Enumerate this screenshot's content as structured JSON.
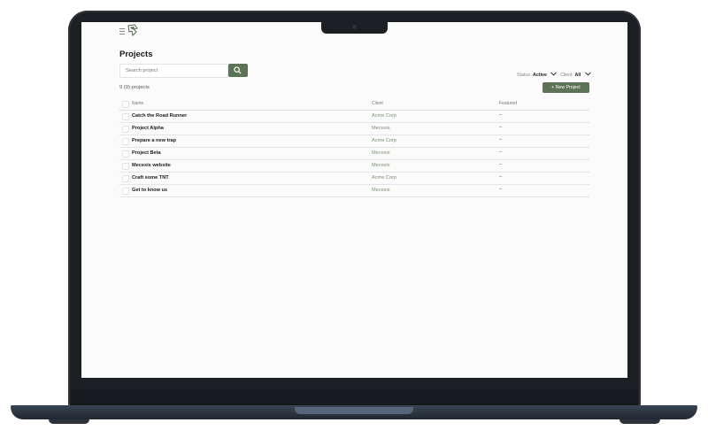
{
  "app": {
    "page_title": "Projects",
    "search": {
      "placeholder": "Search project"
    },
    "filters": {
      "status": {
        "label": "Status",
        "value": "Active"
      },
      "client": {
        "label": "Client",
        "value": "All"
      }
    },
    "project_count": "9 (9) projects",
    "new_project_label": "+ New Project",
    "table": {
      "headers": {
        "name": "Name",
        "client": "Client",
        "featured": "Featured"
      },
      "rows": [
        {
          "name": "Catch the Road Runner",
          "client": "Acme Corp",
          "featured": "–"
        },
        {
          "name": "Project Alpha",
          "client": "Mecexis",
          "featured": "–"
        },
        {
          "name": "Prepare a new trap",
          "client": "Acme Corp",
          "featured": "–"
        },
        {
          "name": "Project Beta",
          "client": "Mecexis",
          "featured": "–"
        },
        {
          "name": "Mecexis website",
          "client": "Mecexis",
          "featured": "–"
        },
        {
          "name": "Craft some TNT",
          "client": "Acme Corp",
          "featured": "–"
        },
        {
          "name": "Get to know us",
          "client": "Mecexis",
          "featured": "–"
        }
      ]
    }
  },
  "icons": {
    "menu": "hamburger-icon",
    "logo": "brand-logo-icon",
    "search": "search-icon",
    "dropdown": "chevron-down-icon"
  },
  "colors": {
    "accent": "#5d7355",
    "client_link": "#7a8f70",
    "laptop_body": "#1c1f24"
  }
}
